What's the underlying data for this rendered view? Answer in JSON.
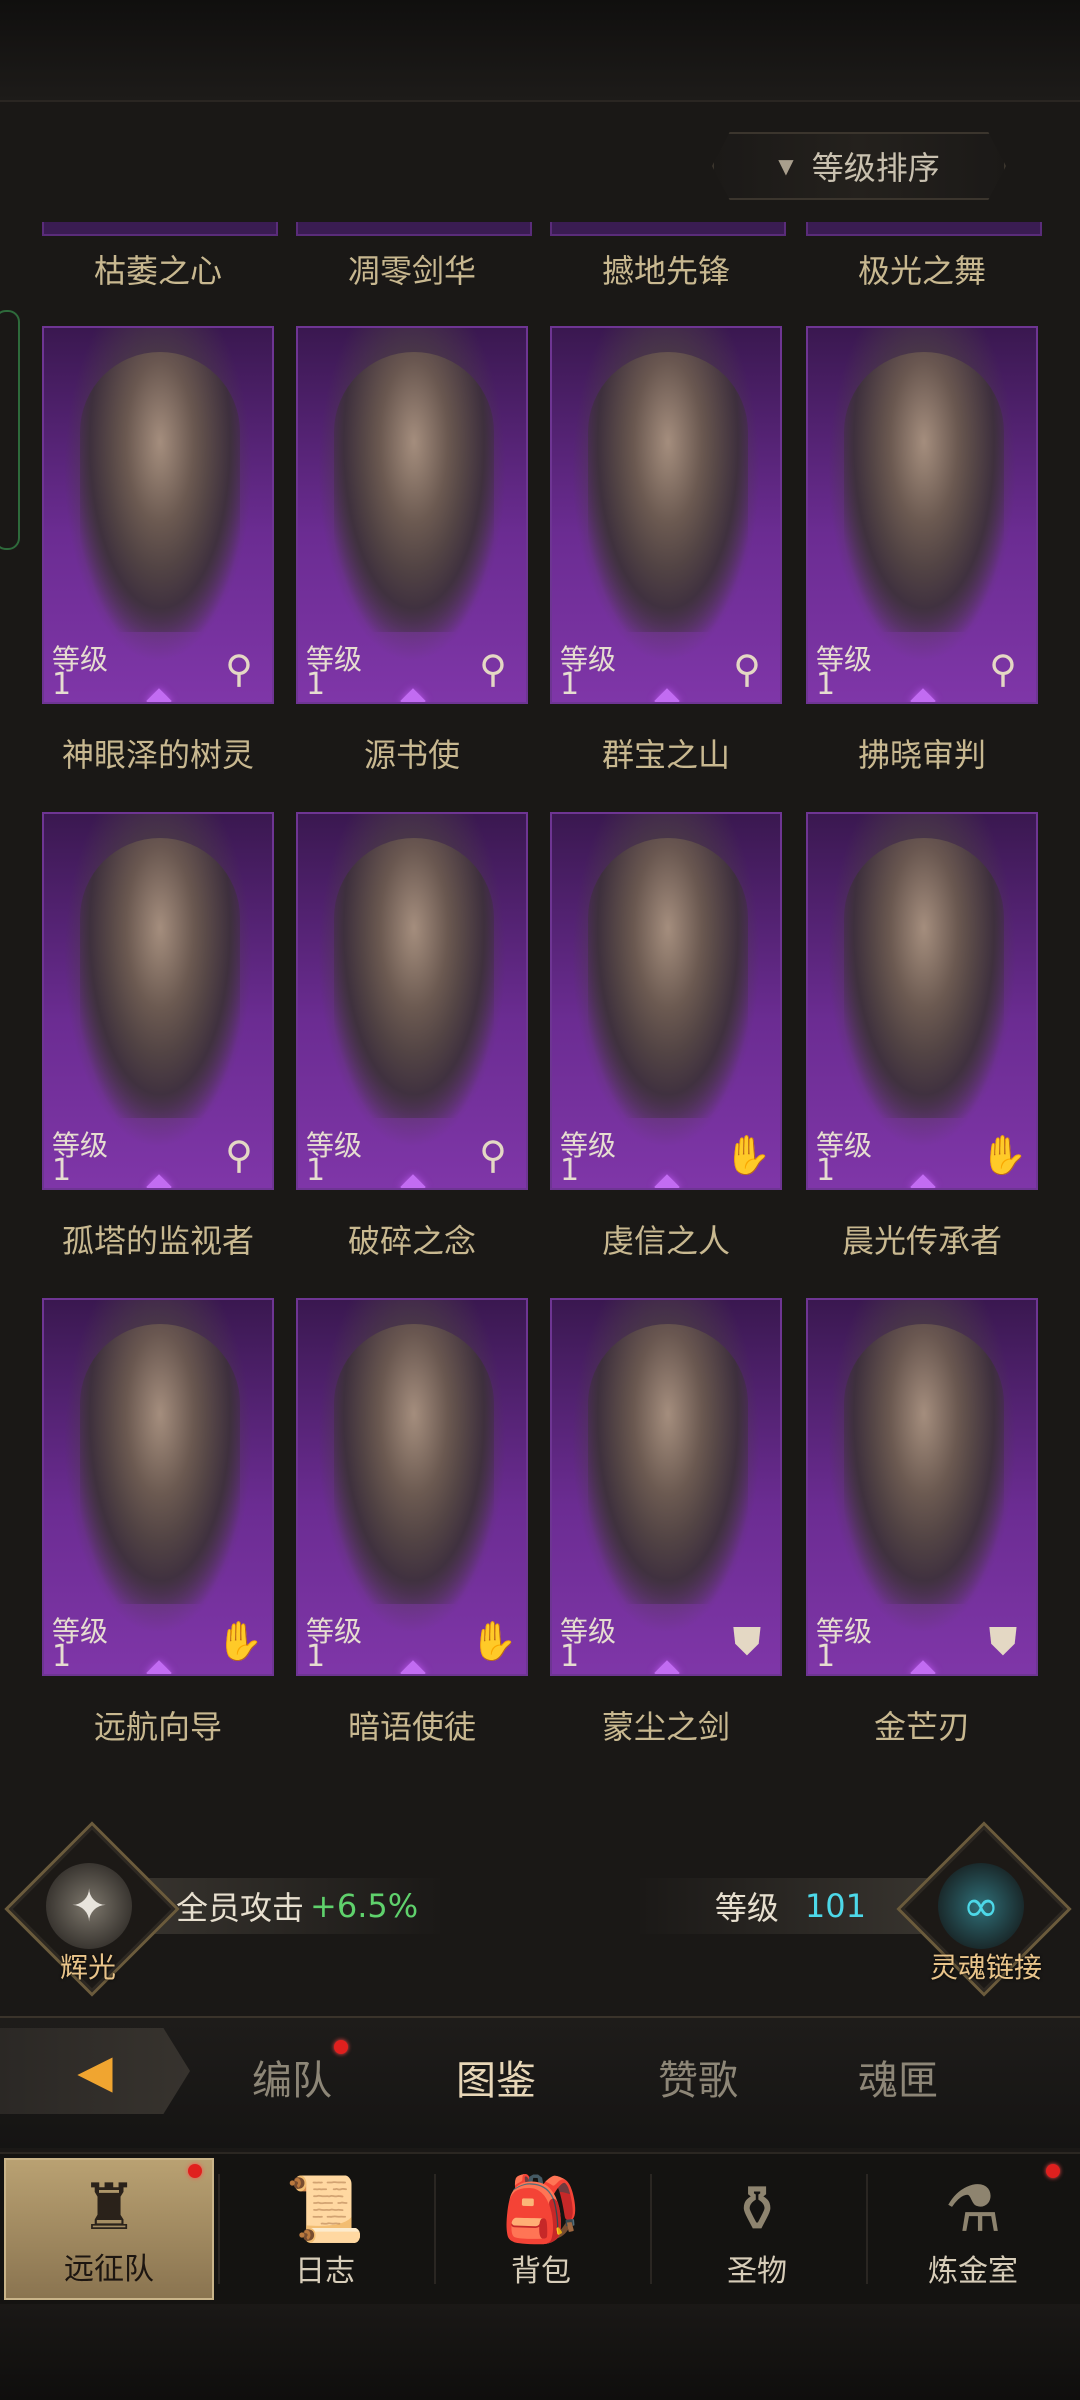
{
  "sort_button": {
    "label": "等级排序"
  },
  "top_row_names": [
    "枯萎之心",
    "凋零剑华",
    "撼地先锋",
    "极光之舞"
  ],
  "rows": [
    [
      {
        "name": "神眼泽的树灵",
        "level_label": "等级",
        "level": "1",
        "class_icon": "magic-key-icon"
      },
      {
        "name": "源书使",
        "level_label": "等级",
        "level": "1",
        "class_icon": "magic-key-icon"
      },
      {
        "name": "群宝之山",
        "level_label": "等级",
        "level": "1",
        "class_icon": "magic-key-icon"
      },
      {
        "name": "拂晓审判",
        "level_label": "等级",
        "level": "1",
        "class_icon": "magic-key-icon"
      }
    ],
    [
      {
        "name": "孤塔的监视者",
        "level_label": "等级",
        "level": "1",
        "class_icon": "magic-key-icon"
      },
      {
        "name": "破碎之念",
        "level_label": "等级",
        "level": "1",
        "class_icon": "magic-key-icon"
      },
      {
        "name": "虔信之人",
        "level_label": "等级",
        "level": "1",
        "class_icon": "hand-icon"
      },
      {
        "name": "晨光传承者",
        "level_label": "等级",
        "level": "1",
        "class_icon": "hand-icon"
      }
    ],
    [
      {
        "name": "远航向导",
        "level_label": "等级",
        "level": "1",
        "class_icon": "hand-icon"
      },
      {
        "name": "暗语使徒",
        "level_label": "等级",
        "level": "1",
        "class_icon": "hand-icon"
      },
      {
        "name": "蒙尘之剑",
        "level_label": "等级",
        "level": "1",
        "class_icon": "shield-icon"
      },
      {
        "name": "金芒刃",
        "level_label": "等级",
        "level": "1",
        "class_icon": "shield-icon"
      }
    ]
  ],
  "bonus": {
    "left_emblem_label": "辉光",
    "attack_label": "全员攻击",
    "attack_value": "+6.5%",
    "level_label": "等级",
    "level_value": "101",
    "right_emblem_label": "灵魂链接"
  },
  "tabs": [
    {
      "label": "编队",
      "badge": true
    },
    {
      "label": "图鉴",
      "active": true
    },
    {
      "label": "赞歌"
    },
    {
      "label": "魂匣"
    }
  ],
  "nav": [
    {
      "label": "远征队",
      "icon": "helmet-icon",
      "active": true,
      "badge": true
    },
    {
      "label": "日志",
      "icon": "scroll-icon"
    },
    {
      "label": "背包",
      "icon": "backpack-icon"
    },
    {
      "label": "圣物",
      "icon": "relic-icon"
    },
    {
      "label": "炼金室",
      "icon": "alchemy-icon",
      "badge": true
    }
  ],
  "colors": {
    "card_purple": "#7f36a8",
    "accent_gold": "#e9c48a",
    "accent_cyan": "#4dd8e8",
    "accent_green": "#5fd16c",
    "badge_red": "#e0201e"
  }
}
